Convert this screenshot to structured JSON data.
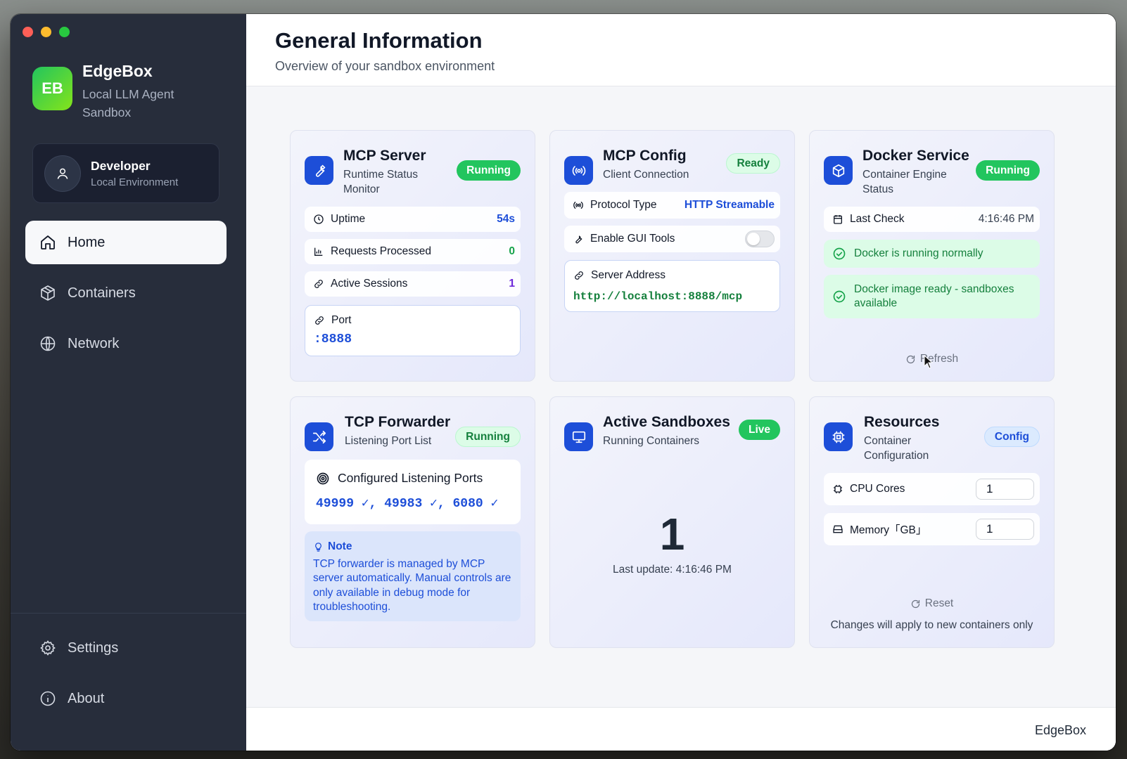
{
  "app": {
    "name": "EdgeBox",
    "subtitle": "Local LLM Agent Sandbox",
    "logo_text": "EB"
  },
  "user": {
    "name": "Developer",
    "environment": "Local Environment"
  },
  "nav": {
    "home": "Home",
    "containers": "Containers",
    "network": "Network",
    "settings": "Settings",
    "about": "About"
  },
  "header": {
    "title": "General Information",
    "subtitle": "Overview of your sandbox environment"
  },
  "mcp_server": {
    "title": "MCP Server",
    "subtitle": "Runtime Status Monitor",
    "status": "Running",
    "uptime_label": "Uptime",
    "uptime_value": "54s",
    "requests_label": "Requests Processed",
    "requests_value": "0",
    "sessions_label": "Active Sessions",
    "sessions_value": "1",
    "port_label": "Port",
    "port_value": ":8888"
  },
  "mcp_config": {
    "title": "MCP Config",
    "subtitle": "Client Connection",
    "status": "Ready",
    "protocol_label": "Protocol Type",
    "protocol_value": "HTTP Streamable",
    "gui_tools_label": "Enable GUI Tools",
    "gui_tools_enabled": false,
    "server_address_label": "Server Address",
    "server_address_value": "http://localhost:8888/mcp"
  },
  "docker": {
    "title": "Docker Service",
    "subtitle": "Container Engine Status",
    "status": "Running",
    "last_check_label": "Last Check",
    "last_check_value": "4:16:46 PM",
    "status_message_1": "Docker is running normally",
    "status_message_2": "Docker image ready - sandboxes available",
    "refresh_label": "Refresh"
  },
  "tcp": {
    "title": "TCP Forwarder",
    "subtitle": "Listening Port List",
    "status": "Running",
    "ports_label": "Configured Listening Ports",
    "ports_value": "49999 ✓, 49983 ✓, 6080 ✓",
    "note_title": "Note",
    "note_text": "TCP forwarder is managed by MCP server automatically. Manual controls are only available in debug mode for troubleshooting."
  },
  "sandboxes": {
    "title": "Active Sandboxes",
    "subtitle": "Running Containers",
    "status": "Live",
    "count": "1",
    "last_update": "Last update: 4:16:46 PM"
  },
  "resources": {
    "title": "Resources",
    "subtitle": "Container Configuration",
    "status": "Config",
    "cpu_label": "CPU Cores",
    "cpu_value": "1",
    "memory_label": "Memory「GB」",
    "memory_value": "1",
    "reset_label": "Reset",
    "footer_note": "Changes will apply to new containers only"
  },
  "footer": {
    "text": "EdgeBox"
  },
  "colors": {
    "sidebar_bg": "#272d3b",
    "accent_blue": "#1d4ed8",
    "status_green": "#22c55e"
  }
}
